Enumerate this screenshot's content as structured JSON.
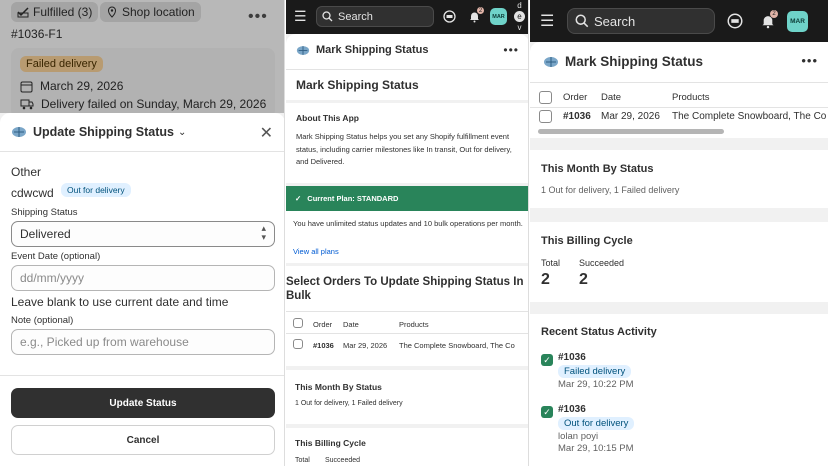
{
  "panel1": {
    "top_chips": {
      "fulfilled": "Fulfilled (3)",
      "shop_location": "Shop location"
    },
    "order_id": "#1036-F1",
    "failed_badge": "Failed delivery",
    "date_line": "March 29, 2026",
    "delivery_line": "Delivery failed on Sunday, March 29, 2026",
    "sheet": {
      "title": "Update Shipping Status",
      "other_label": "Other",
      "carrier_name": "cdwcwd",
      "status_badge": "Out for delivery",
      "shipping_status_label": "Shipping Status",
      "shipping_status_value": "Delivered",
      "event_date_label": "Event Date (optional)",
      "event_date_placeholder": "dd/mm/yyyy",
      "event_date_help": "Leave blank to use current date and time",
      "note_label": "Note (optional)",
      "note_placeholder": "e.g., Picked up from warehouse",
      "update_button": "Update Status",
      "cancel_button": "Cancel"
    }
  },
  "panel2": {
    "search_placeholder": "Search",
    "notification_count": "2",
    "avatar": "MAR",
    "user_initials": [
      "d",
      "e",
      "v"
    ],
    "header_title": "Mark Shipping Status",
    "page_title": "Mark Shipping Status",
    "about_title": "About This App",
    "about_text": "Mark Shipping Status helps you set any Shopify fulfillment event status, including carrier milestones like In transit, Out for delivery, and Delivered.",
    "plan_banner": "Current Plan: STANDARD",
    "plan_text": "You have unlimited status updates and 10 bulk operations per month.",
    "view_plans": "View all plans",
    "select_title": "Select Orders To Update Shipping Status In Bulk",
    "table": {
      "headers": [
        "Order",
        "Date",
        "Products"
      ],
      "rows": [
        {
          "order": "#1036",
          "date": "Mar 29, 2026",
          "products": "The Complete Snowboard, The Co"
        }
      ]
    },
    "month_title": "This Month By Status",
    "month_text": "1 Out for delivery, 1 Failed delivery",
    "billing_title": "This Billing Cycle",
    "billing_headers": [
      "Total",
      "Succeeded"
    ]
  },
  "panel3": {
    "search_placeholder": "Search",
    "notification_count": "2",
    "avatar": "MAR",
    "header_title": "Mark Shipping Status",
    "table": {
      "headers": [
        "Order",
        "Date",
        "Products"
      ],
      "rows": [
        {
          "order": "#1036",
          "date": "Mar 29, 2026",
          "products": "The Complete Snowboard, The Co"
        }
      ]
    },
    "month_title": "This Month By Status",
    "month_text": "1 Out for delivery, 1 Failed delivery",
    "billing_title": "This Billing Cycle",
    "billing": {
      "total_label": "Total",
      "total_value": "2",
      "succeeded_label": "Succeeded",
      "succeeded_value": "2"
    },
    "activity_title": "Recent Status Activity",
    "activity": [
      {
        "order": "#1036",
        "status": "Failed delivery",
        "time": "Mar 29, 10:22 PM",
        "note": ""
      },
      {
        "order": "#1036",
        "status": "Out for delivery",
        "note": "lolan poyi",
        "time": "Mar 29, 10:15 PM"
      }
    ]
  },
  "colors": {
    "dark_bar": "#1a1a1a",
    "success_green": "#29845a",
    "info_badge_bg": "#e0f0ff",
    "warning_badge_bg": "#ffd79d",
    "avatar_bg": "#6fd3c9"
  }
}
